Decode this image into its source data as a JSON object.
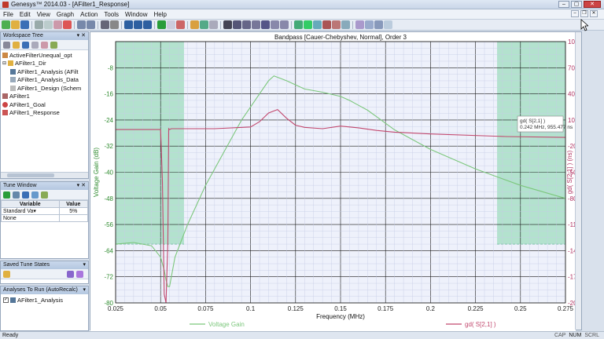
{
  "window": {
    "title": "Genesys™ 2014.03 - [AFilter1_Response]"
  },
  "menus": [
    "File",
    "Edit",
    "View",
    "Graph",
    "Action",
    "Tools",
    "Window",
    "Help"
  ],
  "workspace": {
    "title": "Workspace Tree",
    "items": [
      {
        "label": "ActiveFilterUnequal_opt",
        "indent": 0
      },
      {
        "label": "AFilter1_Dir",
        "indent": 0
      },
      {
        "label": "AFilter1_Analysis (AFilt",
        "indent": 1
      },
      {
        "label": "AFilter1_Analysis_Data",
        "indent": 1
      },
      {
        "label": "AFilter1_Design (Schem",
        "indent": 1
      },
      {
        "label": "AFilter1",
        "indent": 0
      },
      {
        "label": "AFilter1_Goal",
        "indent": 0
      },
      {
        "label": "AFilter1_Response",
        "indent": 0
      }
    ]
  },
  "tune": {
    "title": "Tune Window",
    "headers": [
      "Variable",
      "Value"
    ],
    "rows": [
      {
        "variable": "Standard Va▾",
        "value": "5%"
      },
      {
        "variable": "None",
        "value": ""
      }
    ]
  },
  "saved_states": {
    "title": "Saved Tune States"
  },
  "analyses": {
    "title": "Analyses To Run (AutoRecalc)",
    "items": [
      {
        "label": "AFilter1_Analysis",
        "checked": true
      }
    ]
  },
  "status": {
    "left": "Ready",
    "indicators": [
      "CAP",
      "NUM",
      "SCRL"
    ]
  },
  "chart_data": {
    "type": "line",
    "title": "Bandpass [Cauer-Chebyshev, Normal], Order 3",
    "xlabel": "Frequency (MHz)",
    "ylabel": "Voltage Gain (dB)",
    "y2label": "gd( S[2,1] ) (ns)",
    "xlim": [
      0.025,
      0.275
    ],
    "ylim": [
      -80,
      0
    ],
    "y2lim": [
      -200000,
      100000
    ],
    "x_ticks": [
      "0.025",
      "0.05",
      "0.075",
      "0.1",
      "0.125",
      "0.15",
      "0.175",
      "0.2",
      "0.225",
      "0.25",
      "0.275"
    ],
    "y_ticks": [
      "-8",
      "-16",
      "-24",
      "-32",
      "-40",
      "-48",
      "-56",
      "-64",
      "-72",
      "-80"
    ],
    "y2_ticks": [
      "100000",
      "70000",
      "40000",
      "10000",
      "-20000",
      "-50000",
      "-80000",
      "-110000",
      "-140000",
      "-170000",
      "-200000"
    ],
    "grid": true,
    "series": [
      {
        "name": "Voltage Gain",
        "axis": "left",
        "color": "#7cc77c",
        "x": [
          0.025,
          0.035,
          0.045,
          0.05,
          0.052,
          0.053,
          0.054,
          0.055,
          0.058,
          0.065,
          0.075,
          0.085,
          0.095,
          0.1,
          0.105,
          0.11,
          0.113,
          0.12,
          0.13,
          0.14,
          0.15,
          0.155,
          0.16,
          0.165,
          0.17,
          0.175,
          0.18,
          0.2,
          0.225,
          0.25,
          0.275
        ],
        "values": [
          -62,
          -61.5,
          -62.5,
          -66,
          -70,
          -73,
          -75,
          -75,
          -66,
          -56,
          -44,
          -34,
          -24,
          -20,
          -16,
          -12,
          -10.5,
          -12,
          -14.5,
          -15.5,
          -16.8,
          -18,
          -19.5,
          -21,
          -23,
          -25,
          -27,
          -33,
          -39,
          -44,
          -48
        ]
      },
      {
        "name": "gd( S[2,1] )",
        "axis": "right",
        "color": "#c2486e",
        "x": [
          0.025,
          0.05,
          0.051,
          0.052,
          0.053,
          0.054,
          0.0545,
          0.055,
          0.056,
          0.06,
          0.08,
          0.1,
          0.105,
          0.11,
          0.115,
          0.12,
          0.125,
          0.13,
          0.14,
          0.15,
          0.16,
          0.17,
          0.18,
          0.2,
          0.242,
          0.275
        ],
        "values": [
          -1000,
          -1000,
          -60000,
          -190000,
          -200000,
          -130000,
          0,
          -1000,
          0,
          0,
          0,
          2000,
          8000,
          18000,
          22000,
          12000,
          4000,
          1500,
          0,
          3000,
          1000,
          -2000,
          -4000,
          -6000,
          -9000,
          -10000
        ]
      }
    ],
    "shaded_regions": [
      {
        "x": [
          0.025,
          0.063
        ],
        "y": [
          -62,
          0
        ],
        "color": "#9fdcbf"
      },
      {
        "x": [
          0.237,
          0.275
        ],
        "y": [
          -62,
          0
        ],
        "color": "#9fdcbf"
      }
    ],
    "plot_background": "#eef1fb",
    "tooltip": {
      "title": "gd( S[2,1] )",
      "text": "0.242 MHz, 955.477 ns"
    }
  }
}
